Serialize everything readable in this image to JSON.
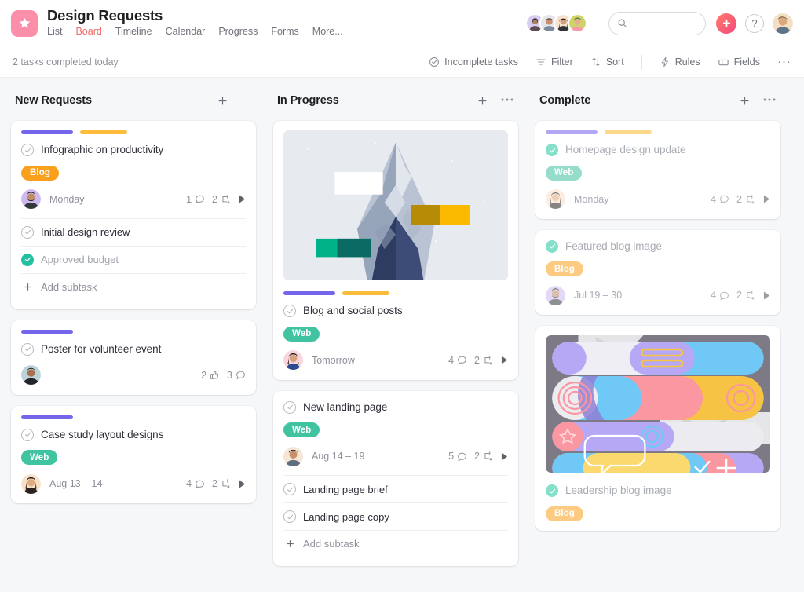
{
  "header": {
    "project_icon": "star-icon",
    "title": "Design Requests",
    "tabs": [
      {
        "label": "List",
        "active": false
      },
      {
        "label": "Board",
        "active": true
      },
      {
        "label": "Timeline",
        "active": false
      },
      {
        "label": "Calendar",
        "active": false
      },
      {
        "label": "Progress",
        "active": false
      },
      {
        "label": "Forms",
        "active": false
      },
      {
        "label": "More...",
        "active": false
      }
    ],
    "search": {
      "value": "",
      "placeholder": "",
      "icon": "search-icon"
    },
    "add_button_icon": "plus-icon",
    "help_button_label": "?",
    "member_avatar_count": 4,
    "accent_color": "#f06a6a"
  },
  "subbar": {
    "completed_today": "2 tasks completed today",
    "items": [
      {
        "label": "Incomplete tasks",
        "icon": "check-circle-icon"
      },
      {
        "label": "Filter",
        "icon": "filter-icon"
      },
      {
        "label": "Sort",
        "icon": "sort-icon"
      },
      {
        "label": "Rules",
        "icon": "lightning-icon"
      },
      {
        "label": "Fields",
        "icon": "fields-icon"
      }
    ],
    "overflow_label": "···"
  },
  "columns": [
    {
      "title": "New Requests",
      "add_icon": "plus-icon",
      "menu_icon": "ellipsis-icon",
      "cards": [
        {
          "title": "Infographic on productivity",
          "completed": false,
          "bars": [
            "purple",
            "yellow"
          ],
          "tag": {
            "label": "Blog",
            "type": "blog"
          },
          "date": "Monday",
          "comments": "1",
          "subtask_count": "2",
          "has_caret": true,
          "avatar": "avatar-bearded-man",
          "subtasks": [
            {
              "label": "Initial design review",
              "completed": false
            },
            {
              "label": "Approved budget",
              "completed": true
            }
          ],
          "add_subtask_label": "Add subtask"
        },
        {
          "title": "Poster for volunteer event",
          "completed": false,
          "bars": [
            "purple"
          ],
          "likes": "2",
          "comments": "3",
          "avatar": "avatar-dark-hair-man"
        },
        {
          "title": "Case study layout designs",
          "completed": false,
          "bars": [
            "purple"
          ],
          "tag": {
            "label": "Web",
            "type": "web"
          },
          "date": "Aug 13 – 14",
          "comments": "4",
          "subtask_count": "2",
          "has_caret": true,
          "avatar": "avatar-long-hair-woman"
        }
      ]
    },
    {
      "title": "In Progress",
      "add_icon": "plus-icon",
      "menu_icon": "ellipsis-icon",
      "cards": [
        {
          "title": "Blog and social posts",
          "completed": false,
          "preview": "mountain-photo",
          "bars": [
            "purple",
            "yellow"
          ],
          "tag": {
            "label": "Web",
            "type": "web"
          },
          "date": "Tomorrow",
          "comments": "4",
          "subtask_count": "2",
          "has_caret": true,
          "avatar": "avatar-woman-pink"
        },
        {
          "title": "New landing page",
          "completed": false,
          "tag": {
            "label": "Web",
            "type": "web"
          },
          "date": "Aug 14 – 19",
          "comments": "5",
          "subtask_count": "2",
          "has_caret": true,
          "avatar": "avatar-young-man",
          "subtasks": [
            {
              "label": "Landing page brief",
              "completed": false
            },
            {
              "label": "Landing page copy",
              "completed": false
            }
          ],
          "add_subtask_label": "Add subtask"
        }
      ]
    },
    {
      "title": "Complete",
      "add_icon": "plus-icon",
      "menu_icon": "ellipsis-icon",
      "cards": [
        {
          "title": "Homepage design update",
          "completed": true,
          "bars": [
            "purple",
            "yellow"
          ],
          "tag": {
            "label": "Web",
            "type": "web"
          },
          "date": "Monday",
          "comments": "4",
          "subtask_count": "2",
          "has_caret": true,
          "avatar": "avatar-long-hair-woman"
        },
        {
          "title": "Featured blog image",
          "completed": true,
          "tag": {
            "label": "Blog",
            "type": "blog"
          },
          "date": "Jul 19 – 30",
          "comments": "4",
          "subtask_count": "2",
          "has_caret": true,
          "avatar": "avatar-bearded-man"
        },
        {
          "title": "Leadership blog image",
          "completed": true,
          "preview": "abstract-illustration",
          "tag": {
            "label": "Blog",
            "type": "blog"
          }
        }
      ]
    }
  ],
  "colors": {
    "accent": "#f06a6a",
    "bar_purple": "#7565eb",
    "bar_yellow": "#fcbd3f",
    "tag_blog": "#fba01c",
    "tag_web": "#3fc3a0",
    "complete_check": "#21c1a0",
    "background": "#f6f7f9"
  }
}
